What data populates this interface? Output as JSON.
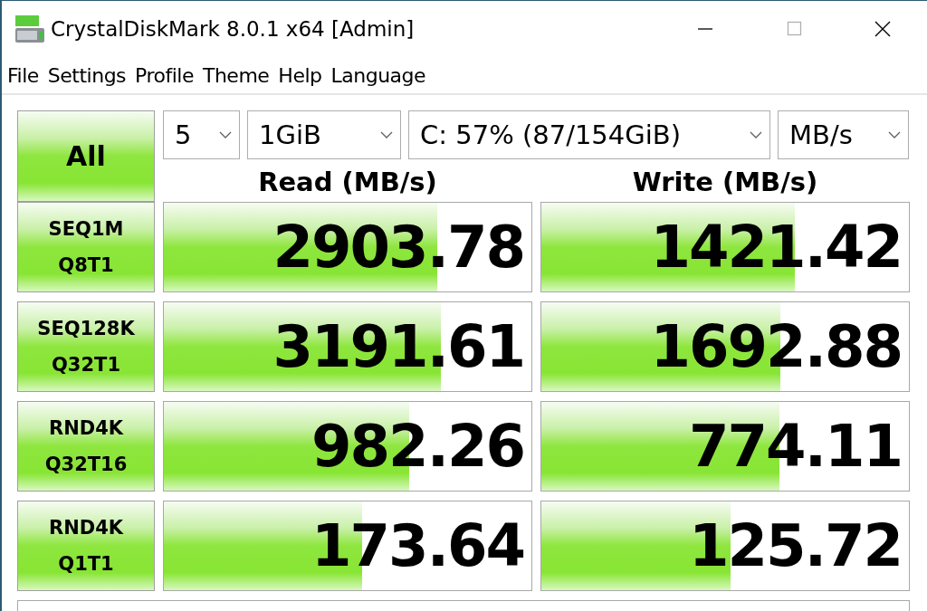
{
  "window": {
    "title": "CrystalDiskMark 8.0.1 x64 [Admin]"
  },
  "menu": [
    "File",
    "Settings",
    "Profile",
    "Theme",
    "Help",
    "Language"
  ],
  "controls": {
    "run_all": "All",
    "count": "5",
    "size": "1GiB",
    "drive": "C: 57% (87/154GiB)",
    "unit": "MB/s"
  },
  "headers": {
    "read": "Read (MB/s)",
    "write": "Write (MB/s)"
  },
  "tests": [
    {
      "name": "SEQ1M",
      "params": "Q8T1",
      "read": {
        "value": "2903.78",
        "level": 0.745
      },
      "write": {
        "value": "1421.42",
        "level": 0.69
      }
    },
    {
      "name": "SEQ128K",
      "params": "Q32T1",
      "read": {
        "value": "3191.61",
        "level": 0.753
      },
      "write": {
        "value": "1692.88",
        "level": 0.65
      }
    },
    {
      "name": "RND4K",
      "params": "Q32T16",
      "read": {
        "value": "982.26",
        "level": 0.667
      },
      "write": {
        "value": "774.11",
        "level": 0.648
      }
    },
    {
      "name": "RND4K",
      "params": "Q1T1",
      "read": {
        "value": "173.64",
        "level": 0.54
      },
      "write": {
        "value": "125.72",
        "level": 0.515
      }
    }
  ]
}
